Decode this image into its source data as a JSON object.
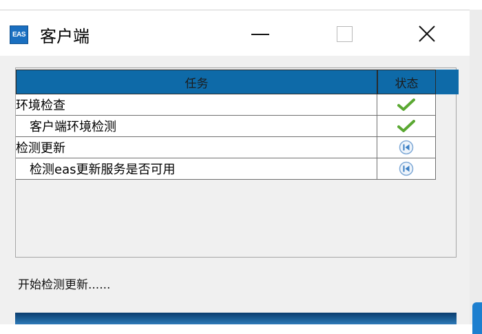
{
  "window": {
    "title": "客户端",
    "app_icon": {
      "name": "eas-app-icon",
      "text": "EAS"
    }
  },
  "table": {
    "headers": {
      "task": "任务",
      "status": "状态"
    },
    "rows": [
      {
        "label": "环境检查",
        "indent": 0,
        "status_icon": "check-icon"
      },
      {
        "label": "客户端环境检测",
        "indent": 1,
        "status_icon": "check-icon"
      },
      {
        "label": "检测更新",
        "indent": 0,
        "status_icon": "skip-back-icon"
      },
      {
        "label": "检测eas更新服务是否可用",
        "indent": 1,
        "status_icon": "skip-back-icon"
      }
    ]
  },
  "status_message": "开始检测更新......",
  "progress": {
    "value": 0
  },
  "colors": {
    "header_blue": "#0e6aa8",
    "check_green": "#5aa832",
    "skip_blue": "#3b7fc4"
  }
}
